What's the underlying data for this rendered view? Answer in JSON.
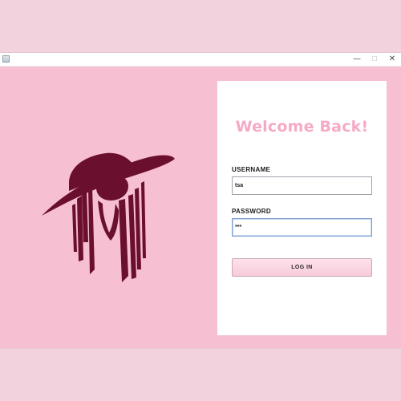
{
  "window": {
    "titlebar": {
      "app_icon": "java-app-icon",
      "minimize_glyph": "—",
      "maximize_glyph": "☐",
      "close_glyph": "✕"
    },
    "background_color": "#f7bfd2"
  },
  "brand": {
    "logo": "woman-in-hat-logo",
    "logo_color": "#6b0f2e"
  },
  "login": {
    "title": "Welcome Back!",
    "title_color": "#f6a9c6",
    "username_label": "USERNAME",
    "username_value": "tsa",
    "password_label": "PASSWORD",
    "password_value": "***",
    "login_button_label": "LOG IN"
  }
}
